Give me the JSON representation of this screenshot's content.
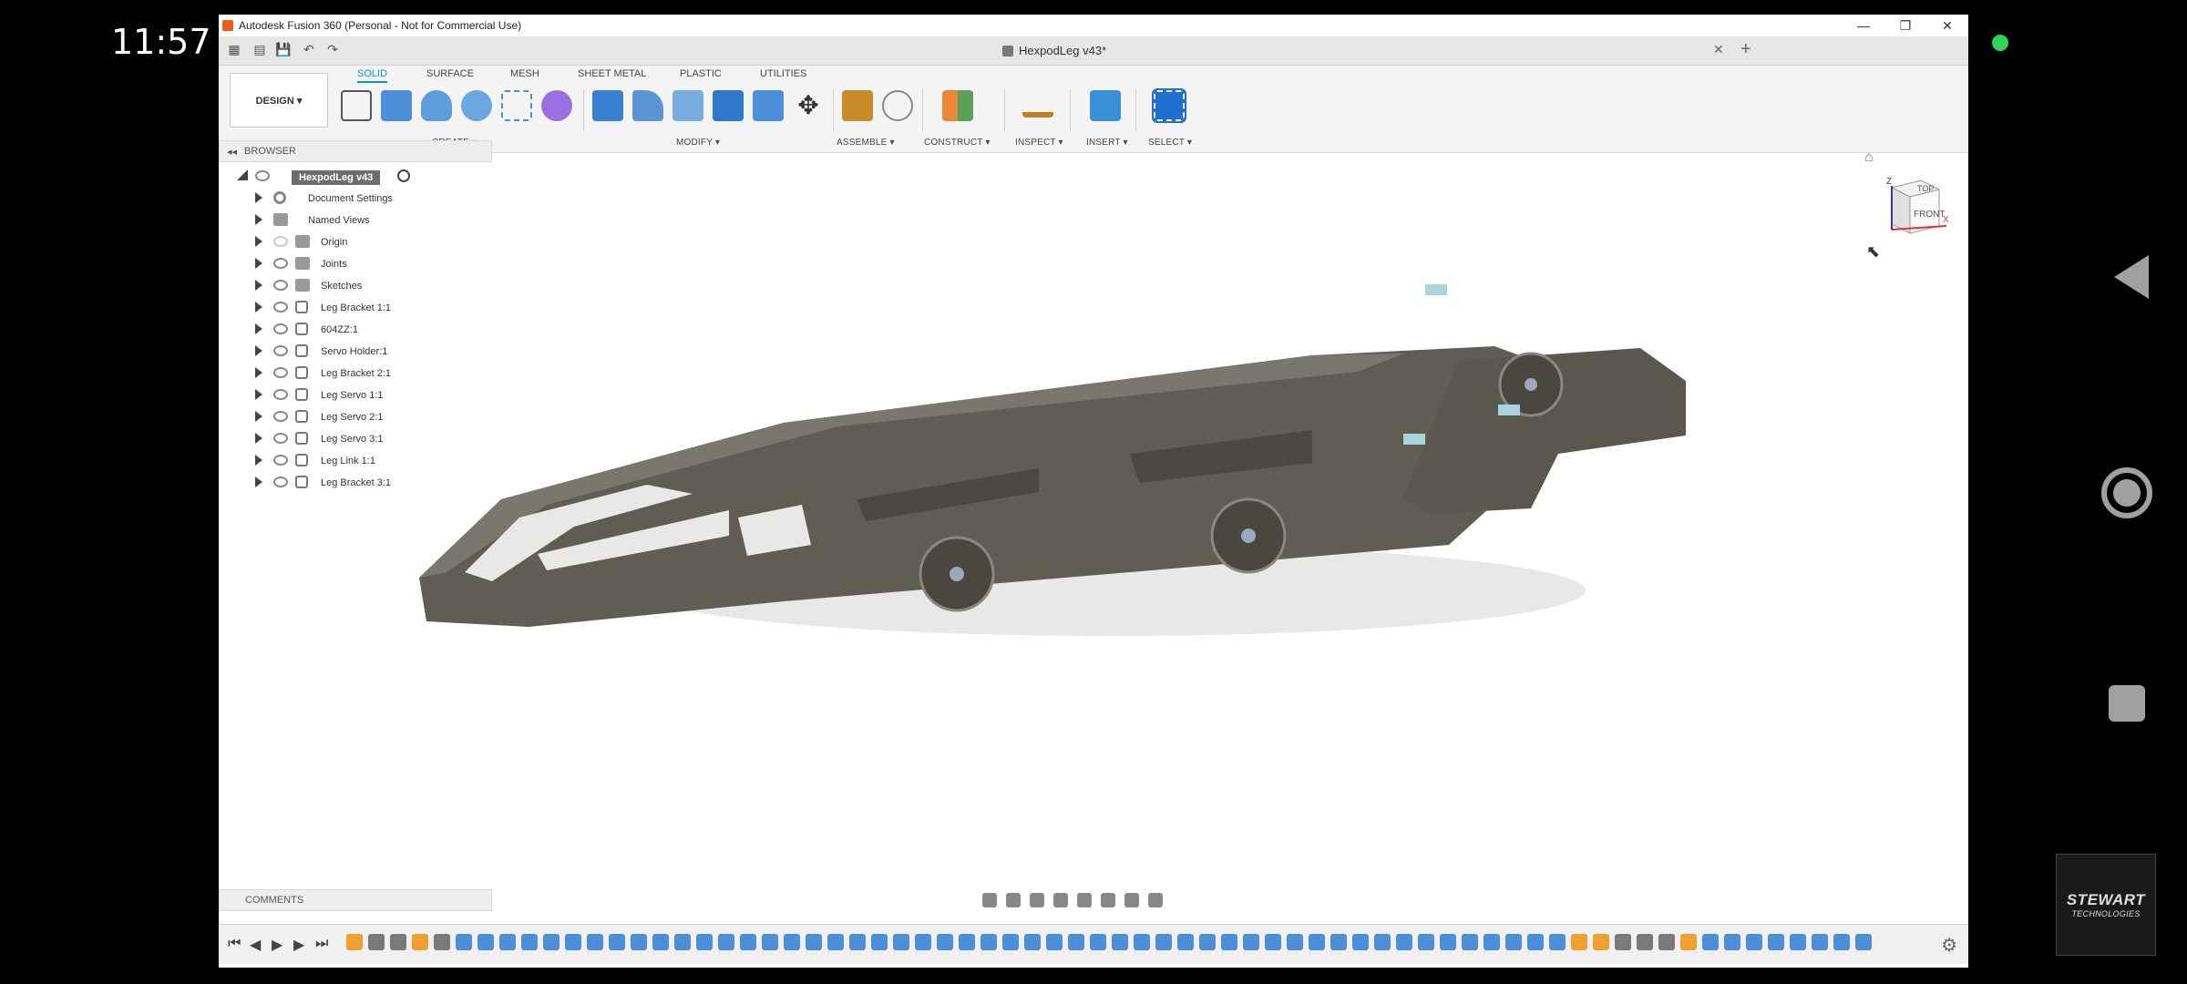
{
  "phone": {
    "time": "11:57"
  },
  "window": {
    "title": "Autodesk Fusion 360 (Personal - Not for Commercial Use)",
    "controls": [
      "—",
      "❐",
      "✕"
    ]
  },
  "quick_access": {
    "doc_tab_title": "HexpodLeg v43*",
    "close_glyph": "✕",
    "add_glyph": "+"
  },
  "ribbon": {
    "workspace": "DESIGN ▾",
    "tabs": [
      {
        "label": "SOLID",
        "active": true
      },
      {
        "label": "SURFACE",
        "active": false
      },
      {
        "label": "MESH",
        "active": false
      },
      {
        "label": "SHEET METAL",
        "active": false
      },
      {
        "label": "PLASTIC",
        "active": false
      },
      {
        "label": "UTILITIES",
        "active": false
      }
    ],
    "groups": [
      "CREATE ▾",
      "MODIFY ▾",
      "ASSEMBLE ▾",
      "CONSTRUCT ▾",
      "INSPECT ▾",
      "INSERT ▾",
      "SELECT ▾"
    ],
    "tool_colors": {
      "create": "#4a8fd8",
      "modify": "#3b7fd0",
      "assemble": "#c78b2a",
      "construct": "#e8863c",
      "inspect": "#c57c1a",
      "insert": "#3a8fd9",
      "select": "#1f6fd1"
    }
  },
  "browser": {
    "header": "BROWSER",
    "root": "HexpodLeg v43",
    "items": [
      {
        "label": "Document Settings",
        "icon": "gear-icon",
        "visible": true
      },
      {
        "label": "Named Views",
        "icon": "folder-icon",
        "visible": false
      },
      {
        "label": "Origin",
        "icon": "folder-icon",
        "visible": true,
        "dim": true
      },
      {
        "label": "Joints",
        "icon": "folder-icon",
        "visible": true
      },
      {
        "label": "Sketches",
        "icon": "folder-icon",
        "visible": true
      },
      {
        "label": "Leg Bracket 1:1",
        "icon": "component-icon",
        "visible": true
      },
      {
        "label": "604ZZ:1",
        "icon": "component-icon",
        "visible": true
      },
      {
        "label": "Servo Holder:1",
        "icon": "component-icon",
        "visible": true
      },
      {
        "label": "Leg Bracket 2:1",
        "icon": "component-icon",
        "visible": true
      },
      {
        "label": "Leg Servo 1:1",
        "icon": "component-icon",
        "visible": true
      },
      {
        "label": "Leg Servo 2:1",
        "icon": "component-icon",
        "visible": true
      },
      {
        "label": "Leg Servo 3:1",
        "icon": "component-icon",
        "visible": true
      },
      {
        "label": "Leg Link 1:1",
        "icon": "component-icon",
        "visible": true
      },
      {
        "label": "Leg Bracket 3:1",
        "icon": "component-icon",
        "visible": true
      }
    ]
  },
  "viewcube": {
    "top": "TOP",
    "front": "FRONT",
    "axis_x": "X",
    "axis_z": "Z"
  },
  "comments": {
    "label": "COMMENTS"
  },
  "playback": {
    "first": "⏮",
    "prev": "◀",
    "play": "▶",
    "next": "▶",
    "last": "⏭"
  },
  "watermark": {
    "line1": "STEWART",
    "line2": "TECHNOLOGIES"
  },
  "colors": {
    "model": "#5a5a50",
    "accent": "#0696d7",
    "status_dot": "#2fd35c"
  }
}
